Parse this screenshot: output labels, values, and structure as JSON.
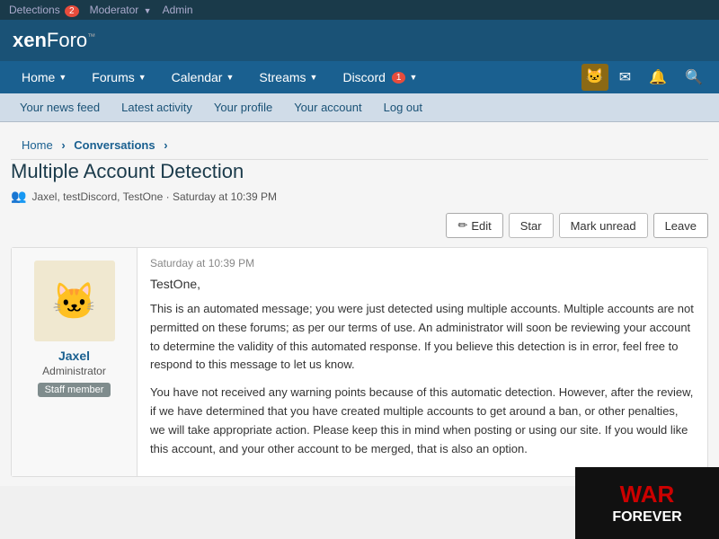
{
  "adminBar": {
    "detections_label": "Detections",
    "detections_count": "2",
    "moderator_label": "Moderator",
    "admin_label": "Admin"
  },
  "logo": {
    "xen": "xen",
    "foro": "Foro",
    "tm": "™"
  },
  "mainNav": {
    "items": [
      {
        "label": "Home",
        "hasDropdown": true
      },
      {
        "label": "Forums",
        "hasDropdown": true
      },
      {
        "label": "Calendar",
        "hasDropdown": true
      },
      {
        "label": "Streams",
        "hasDropdown": true
      },
      {
        "label": "Discord",
        "hasDropdown": true,
        "badge": "1"
      }
    ]
  },
  "subNav": {
    "items": [
      {
        "label": "Your news feed"
      },
      {
        "label": "Latest activity"
      },
      {
        "label": "Your profile"
      },
      {
        "label": "Your account"
      },
      {
        "label": "Log out"
      }
    ]
  },
  "breadcrumb": {
    "home": "Home",
    "conversations": "Conversations"
  },
  "page": {
    "title": "Multiple Account Detection",
    "meta": "Jaxel, testDiscord, TestOne · Saturday at 10:39 PM",
    "meta_icon": "👥"
  },
  "actions": {
    "edit": "Edit",
    "star": "Star",
    "mark_unread": "Mark unread",
    "leave": "Leave"
  },
  "message": {
    "timestamp": "Saturday at 10:39 PM",
    "greeting": "TestOne,",
    "paragraph1": "This is an automated message; you were just detected using multiple accounts. Multiple accounts are not permitted on these forums; as per our terms of use. An administrator will soon be reviewing your account to determine the validity of this automated response. If you believe this detection is in error, feel free to respond to this message to let us know.",
    "paragraph2": "You have not received any warning points because of this automatic detection. However, after the review, if we have determined that you have created multiple accounts to get around a ban, or other penalties, we will take appropriate action. Please keep this in mind when posting or using our site. If you would like this account, and your other account to be merged, that is also an option."
  },
  "author": {
    "name": "Jaxel",
    "role": "Administrator",
    "badge": "Staff member"
  },
  "watermark": {
    "war": "WAR",
    "forever": "FOREVER"
  }
}
